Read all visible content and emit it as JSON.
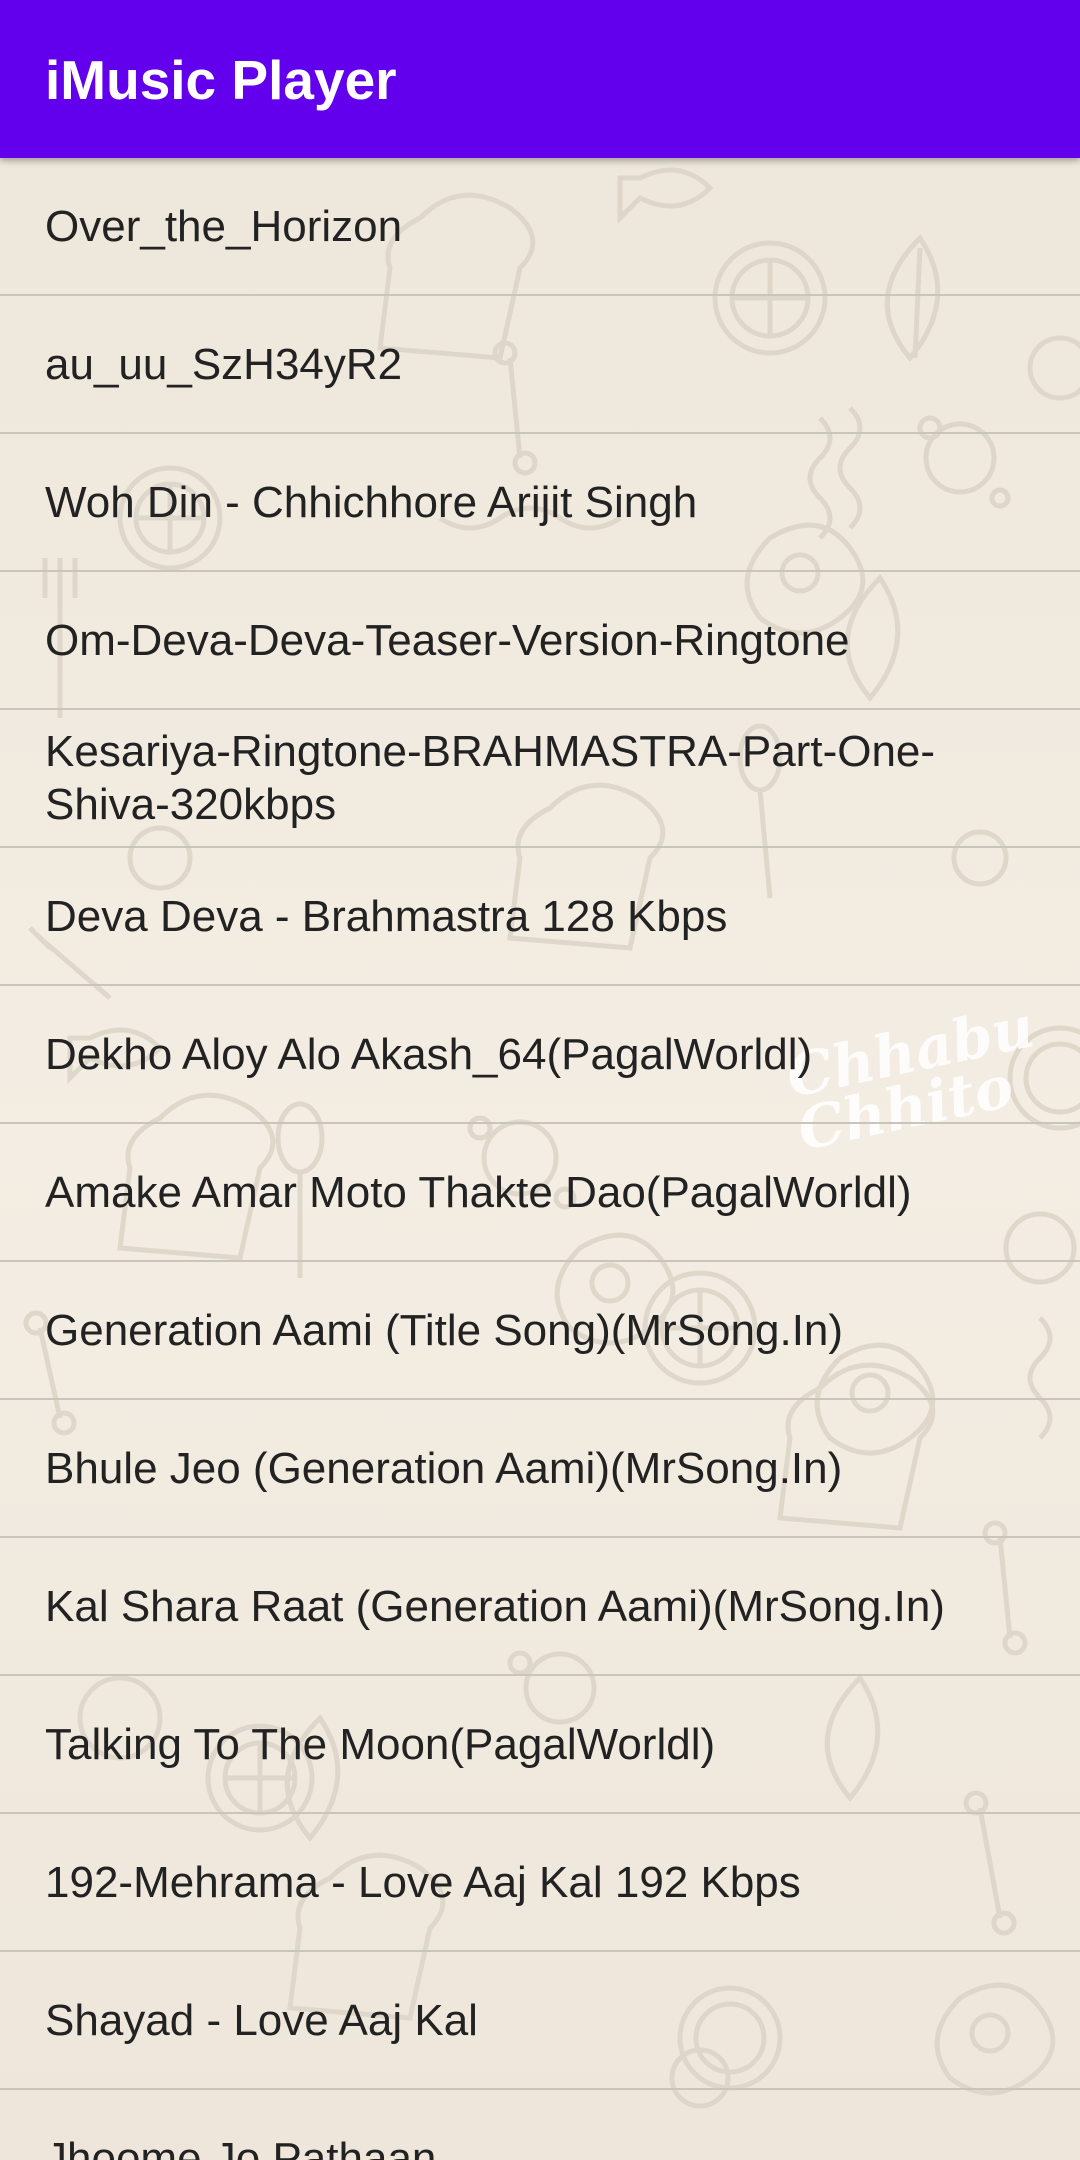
{
  "app_bar": {
    "title": "iMusic Player",
    "background_color": "#6200ee"
  },
  "songs": [
    {
      "title": "Over_the_Horizon"
    },
    {
      "title": "au_uu_SzH34yR2"
    },
    {
      "title": "Woh Din - Chhichhore Arijit Singh"
    },
    {
      "title": "Om-Deva-Deva-Teaser-Version-Ringtone"
    },
    {
      "title": "Kesariya-Ringtone-BRAHMASTRA-Part-One-Shiva-320kbps"
    },
    {
      "title": "Deva Deva - Brahmastra 128 Kbps"
    },
    {
      "title": "Dekho Aloy Alo Akash_64(PagalWorldl)"
    },
    {
      "title": "Amake Amar Moto Thakte Dao(PagalWorldl)"
    },
    {
      "title": "Generation Aami (Title Song)(MrSong.In)"
    },
    {
      "title": "Bhule Jeo (Generation Aami)(MrSong.In)"
    },
    {
      "title": "Kal Shara Raat (Generation Aami)(MrSong.In)"
    },
    {
      "title": "Talking To The Moon(PagalWorldl)"
    },
    {
      "title": "192-Mehrama - Love Aaj Kal 192 Kbps"
    },
    {
      "title": "Shayad - Love Aaj Kal"
    },
    {
      "title": "Jhoome Jo Pathaan"
    }
  ],
  "background": {
    "wallpaper_watermark": "Chhabu Chhito"
  }
}
